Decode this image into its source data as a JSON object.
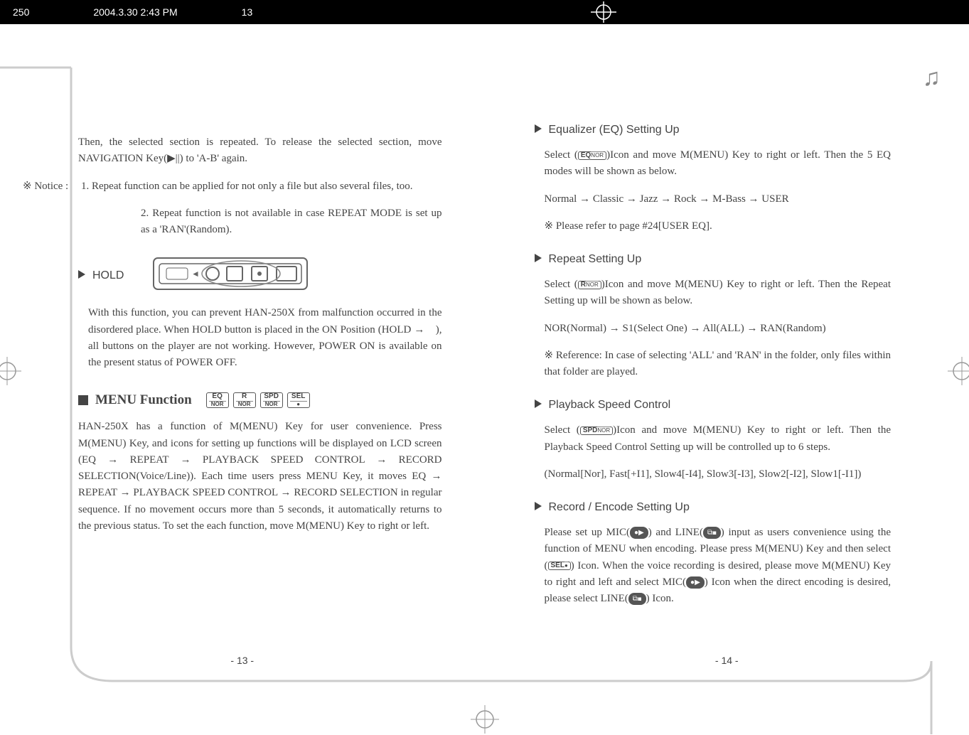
{
  "header": {
    "doc_id": "250",
    "timestamp": "2004.3.30 2:43 PM",
    "page_marker": "13"
  },
  "left_page": {
    "intro": "Then, the selected section is repeated. To release the selected section, move NAVIGATION Key(▶||) to 'A-B' again.",
    "note_label": "※ Notice :",
    "note1": "1. Repeat function can be applied for not only a file but also several files, too.",
    "note2": "2. Repeat function is not available in case REPEAT MODE is set up as a 'RAN'(Random).",
    "hold_title": "HOLD",
    "hold_body": "With this function, you can prevent HAN-250X from malfunction occurred in the disordered place. When HOLD button is placed in the ON Position (HOLD →　), all buttons on the player are not working. However, POWER ON is available on the present status of POWER OFF.",
    "menu_title": "MENU Function",
    "menu_icons": [
      "EQ/NOR",
      "R/NOR",
      "SPD/NOR",
      "SEL/—"
    ],
    "menu_body": "HAN-250X has a function of M(MENU) Key for user convenience. Press M(MENU) Key, and icons for setting up functions will be displayed on LCD screen (EQ → REPEAT → PLAYBACK SPEED CONTROL → RECORD SELECTION(Voice/Line)). Each time users press MENU Key, it moves EQ → REPEAT → PLAYBACK SPEED CONTROL → RECORD SELECTION in regular sequence. If no movement occurs more than 5 seconds, it automatically returns to the previous status. To set the each function, move M(MENU) Key to right or left.",
    "page_num": "- 13 -"
  },
  "right_page": {
    "eq_title": "Equalizer (EQ) Setting Up",
    "eq_body1": "Select (       )Icon and move M(MENU) Key to right or left. Then the 5 EQ modes will be shown as below.",
    "eq_seq": "Normal → Classic → Jazz → Rock → M-Bass → USER",
    "eq_note": "※ Please refer to page #24[USER EQ].",
    "rep_title": "Repeat Setting Up",
    "rep_body1": "Select (       )Icon and move M(MENU) Key to right or left. Then the Repeat Setting up will be shown as below.",
    "rep_seq": "NOR(Normal) → S1(Select One) → All(ALL) → RAN(Random)",
    "rep_ref_label": "※ Reference:",
    "rep_ref": "In case of selecting 'ALL' and 'RAN' in the folder, only files within that folder are played.",
    "spd_title": "Playback Speed Control",
    "spd_body1": "Select (       )Icon and move M(MENU) Key to right or left. Then the Playback Speed Control Setting up will be controlled up to 6 steps.",
    "spd_list": "(Normal[Nor], Fast[+I1], Slow4[-I4], Slow3[-I3], Slow2[-I2],  Slow1[-I1])",
    "rec_title": "Record / Encode Setting Up",
    "rec_body": "Please set up MIC(        ) and LINE(        ) input as users convenience using the function of MENU when encoding. Please press M(MENU) Key and then select (       ) Icon. When the voice recording is desired, please move M(MENU) Key to right and left and select MIC(        ) Icon when the direct encoding is desired, please select LINE(        ) Icon.",
    "page_num": "- 14 -"
  }
}
